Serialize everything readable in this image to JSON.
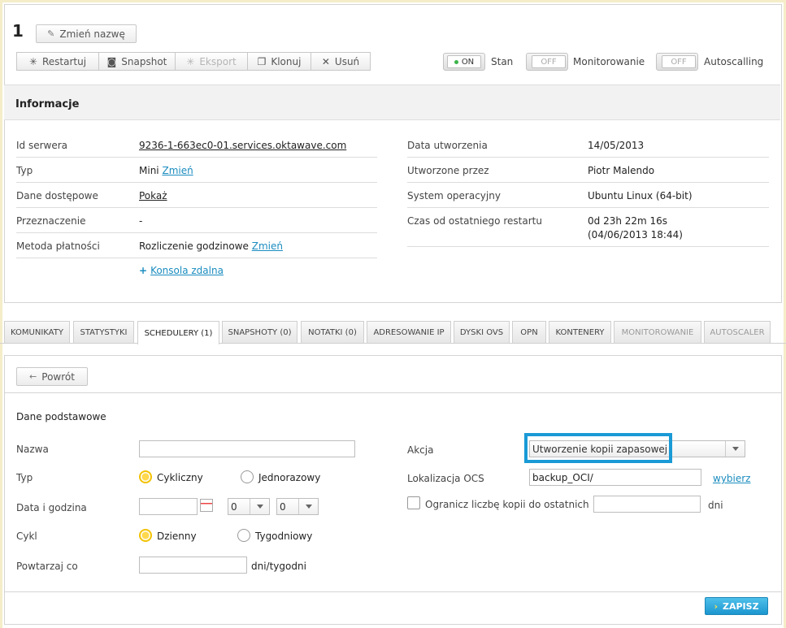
{
  "server": {
    "number": "1",
    "rename_label": "Zmień nazwę"
  },
  "toolbar": {
    "restart": "Restartuj",
    "snapshot": "Snapshot",
    "export": "Eksport",
    "clone": "Klonuj",
    "delete": "Usuń"
  },
  "toggles": {
    "state": {
      "value": "ON",
      "label": "Stan"
    },
    "monitoring": {
      "value": "OFF",
      "label": "Monitorowanie"
    },
    "autoscaling": {
      "value": "OFF",
      "label": "Autoscalling"
    }
  },
  "info": {
    "title": "Informacje",
    "left": [
      {
        "key": "Id serwera",
        "value": "9236-1-663ec0-01.services.oktawave.com",
        "link": ""
      },
      {
        "key": "Typ",
        "value": "Mini",
        "link": "Zmień"
      },
      {
        "key": "Dane dostępowe",
        "value": "",
        "link": "Pokaż"
      },
      {
        "key": "Przeznaczenie",
        "value": "-",
        "link": ""
      },
      {
        "key": "Metoda płatności",
        "value": "Rozliczenie godzinowe",
        "link": "Zmień"
      }
    ],
    "console_link": "Konsola zdalna",
    "right": [
      {
        "key": "Data utworzenia",
        "value": "14/05/2013"
      },
      {
        "key": "Utworzone przez",
        "value": "Piotr Malendo"
      },
      {
        "key": "System operacyjny",
        "value": "Ubuntu Linux (64-bit)"
      },
      {
        "key": "Czas od ostatniego restartu",
        "value": "0d 23h 22m 16s",
        "value2": "(04/06/2013 18:44)"
      }
    ]
  },
  "tabs": [
    {
      "label": "KOMUNIKATY"
    },
    {
      "label": "STATYSTYKI"
    },
    {
      "label": "SCHEDULERY (1)"
    },
    {
      "label": "SNAPSHOTY (0)"
    },
    {
      "label": "NOTATKI (0)"
    },
    {
      "label": "ADRESOWANIE IP"
    },
    {
      "label": "DYSKI OVS"
    },
    {
      "label": "OPN"
    },
    {
      "label": "KONTENERY"
    },
    {
      "label": "MONITOROWANIE"
    },
    {
      "label": "AUTOSCALER"
    }
  ],
  "form": {
    "back_label": "Powrót",
    "section_title": "Dane podstawowe",
    "name_label": "Nazwa",
    "name_value": "",
    "type_label": "Typ",
    "type_cyclic": "Cykliczny",
    "type_once": "Jednorazowy",
    "datetime_label": "Data i godzina",
    "hour_value": "0",
    "minute_value": "0",
    "cycle_label": "Cykl",
    "cycle_daily": "Dzienny",
    "cycle_weekly": "Tygodniowy",
    "repeat_label": "Powtarzaj co",
    "repeat_unit": "dni/tygodni",
    "action_label": "Akcja",
    "action_value": "Utworzenie kopii zapasowej",
    "ocs_label": "Lokalizacja OCS",
    "ocs_value": "backup_OCI/",
    "ocs_choose": "wybierz",
    "limit_label": "Ogranicz liczbę kopii do ostatnich",
    "limit_unit": "dni",
    "save_label": "ZAPISZ"
  }
}
